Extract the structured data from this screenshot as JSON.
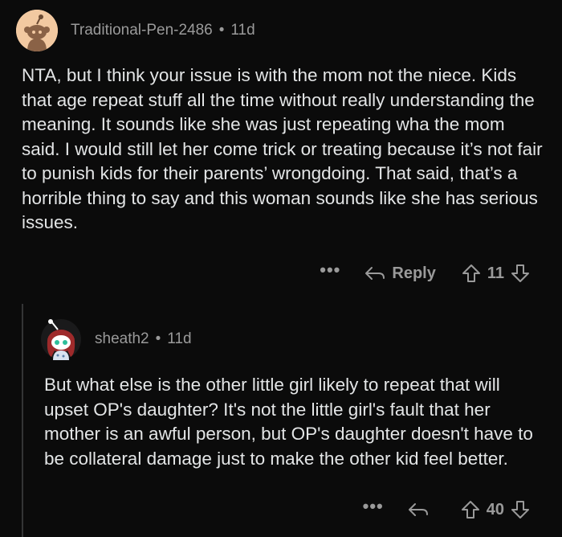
{
  "comments": [
    {
      "author": "Traditional-Pen-2486",
      "separator": "•",
      "age": "11d",
      "body": "NTA, but I think your issue is with the mom not the niece. Kids that age repeat stuff all the time without really understanding the meaning. It sounds like she was just repeating wha the mom said. I would still let her come trick or treating because it’s not fair to punish kids for their parents’ wrongdoing. That said, that’s a horrible thing to say and this woman sounds like she has serious issues.",
      "more_label": "•••",
      "reply_label": "Reply",
      "score": "11"
    },
    {
      "author": "sheath2",
      "separator": "•",
      "age": "11d",
      "body": "But what else is the other little girl likely to repeat that will upset OP's daughter? It's not the little girl's fault that her mother is an awful person, but OP's daughter doesn't have to be collateral damage just to make the other kid feel better.",
      "more_label": "•••",
      "score": "40"
    }
  ],
  "colors": {
    "background": "#0b0b0b",
    "text": "#e3e5e6",
    "meta": "#9a9a9a",
    "thread_line": "#343536",
    "avatar1_bg": "#f2c9a1"
  },
  "icons": {
    "avatar1": "snoo-avatar-icon",
    "avatar2": "snoo-redhead-avatar-icon",
    "reply": "reply-arrow-icon",
    "upvote": "upvote-arrow-icon",
    "downvote": "downvote-arrow-icon",
    "more": "more-options-icon"
  }
}
